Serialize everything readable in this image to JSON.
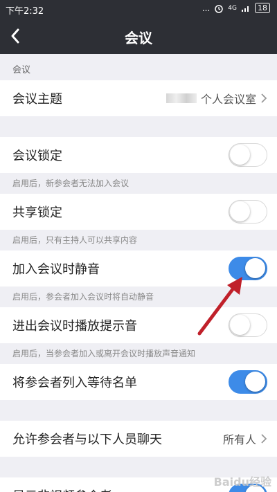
{
  "status_bar": {
    "time": "下午2:32",
    "signal": "...",
    "network": "4G",
    "battery": "18"
  },
  "nav": {
    "title": "会议"
  },
  "section_header": "会议",
  "topic": {
    "label": "会议主题",
    "value": "个人会议室"
  },
  "lock_meeting": {
    "label": "会议锁定",
    "hint": "启用后，新参会者无法加入会议",
    "on": false
  },
  "lock_share": {
    "label": "共享锁定",
    "hint": "启用后，只有主持人可以共享内容",
    "on": false
  },
  "mute_on_join": {
    "label": "加入会议时静音",
    "hint": "启用后，参会者加入会议时将自动静音",
    "on": true
  },
  "chime": {
    "label": "进出会议时播放提示音",
    "hint": "启用后，当参会者加入或离开会议时播放声音通知",
    "on": false
  },
  "waiting_room": {
    "label": "将参会者列入等待名单",
    "on": true
  },
  "chat": {
    "label": "允许参会者与以下人员聊天",
    "value": "所有人"
  },
  "non_video": {
    "label": "显示非视频参会者",
    "on": true
  },
  "watermark": "Baidu经验",
  "colors": {
    "toggle_on": "#3d8be8",
    "bar": "#2d2f35",
    "annotation": "#c0202a"
  }
}
